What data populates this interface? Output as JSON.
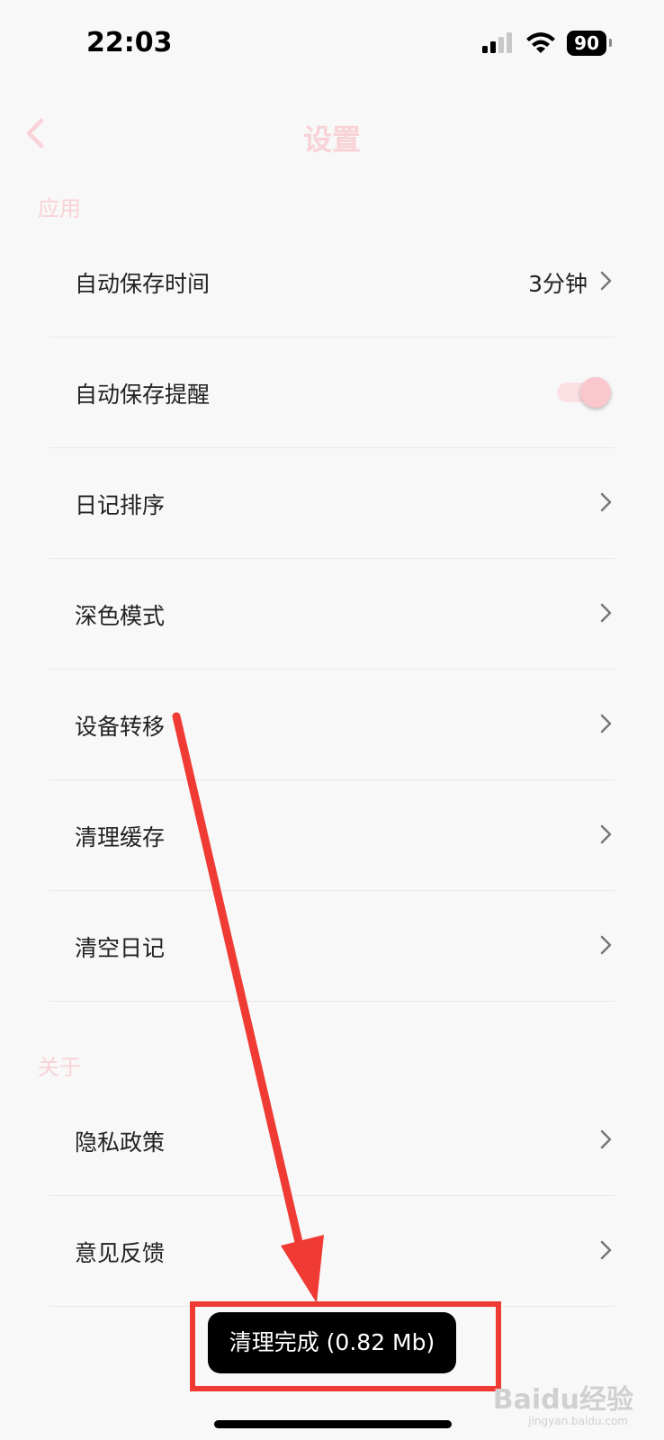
{
  "status_bar": {
    "time": "22:03",
    "battery": "90"
  },
  "nav": {
    "title": "设置"
  },
  "sections": {
    "app": {
      "label": "应用",
      "items": [
        {
          "label": "自动保存时间",
          "value": "3分钟"
        },
        {
          "label": "自动保存提醒",
          "toggle_on": true
        },
        {
          "label": "日记排序"
        },
        {
          "label": "深色模式"
        },
        {
          "label": "设备转移"
        },
        {
          "label": "清理缓存"
        },
        {
          "label": "清空日记"
        }
      ]
    },
    "about": {
      "label": "关于",
      "items": [
        {
          "label": "隐私政策"
        },
        {
          "label": "意见反馈"
        }
      ]
    }
  },
  "toast": {
    "text": "清理完成 (0.82 Mb)"
  },
  "watermark": {
    "text": "Baidu经验",
    "sub": "jingyan.baidu.com"
  },
  "colors": {
    "accent_pink": "#f8d2d6",
    "annotation_red": "#ef3b33"
  }
}
